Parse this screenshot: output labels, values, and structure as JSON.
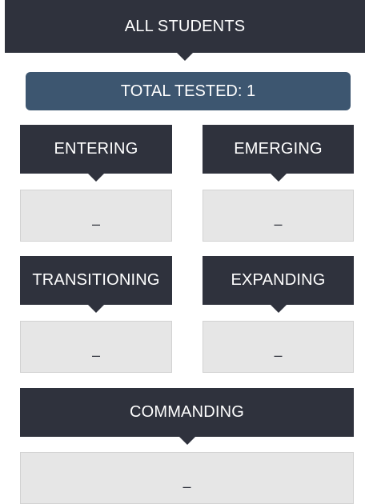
{
  "all_students_label": "ALL STUDENTS",
  "total_tested": {
    "text": "TOTAL TESTED: 1"
  },
  "levels": [
    {
      "label": "ENTERING",
      "value": "–"
    },
    {
      "label": "EMERGING",
      "value": "–"
    },
    {
      "label": "TRANSITIONING",
      "value": "–"
    },
    {
      "label": "EXPANDING",
      "value": "–"
    },
    {
      "label": "COMMANDING",
      "value": "–"
    }
  ],
  "colors": {
    "header_bg": "#2f323d",
    "total_bg": "#3d5670",
    "value_box_bg": "#e6e6e6",
    "value_box_border": "#d2d2d2"
  }
}
